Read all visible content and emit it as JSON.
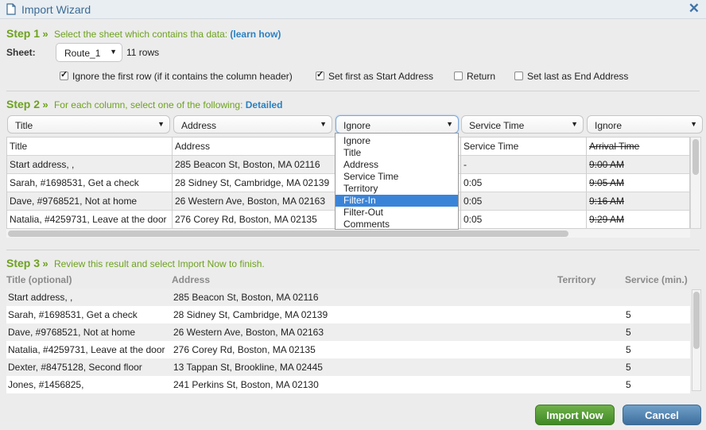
{
  "window": {
    "title": "Import Wizard",
    "close_label": "✕"
  },
  "step1": {
    "label": "Step 1",
    "text": "Select the sheet which contains tha data:",
    "link": "(learn how)",
    "sheet_label": "Sheet:",
    "sheet_value": "Route_1",
    "rows_count": "11 rows",
    "checkboxes": [
      {
        "label": "Ignore the first row (if it contains the column header)",
        "checked": true
      },
      {
        "label": "Set first as Start Address",
        "checked": true
      },
      {
        "label": "Return",
        "checked": false
      },
      {
        "label": "Set last as End Address",
        "checked": false
      }
    ]
  },
  "step2": {
    "label": "Step 2",
    "text": "For each column, select one of the following:",
    "link": "Detailed",
    "column_selects": [
      "Title",
      "Address",
      "Ignore",
      "Service Time",
      "Ignore"
    ],
    "dropdown_options": [
      "Ignore",
      "Title",
      "Address",
      "Service Time",
      "Territory",
      "Filter-In",
      "Filter-Out",
      "Comments"
    ],
    "dropdown_selected": "Filter-In",
    "table": {
      "rows": [
        [
          "Title",
          "Address",
          "",
          "Service Time",
          "Arrival Time"
        ],
        [
          "Start address, ,",
          "285 Beacon St, Boston, MA 02116",
          "",
          "-",
          "9:00 AM"
        ],
        [
          "Sarah, #1698531, Get a check",
          "28 Sidney St, Cambridge, MA 02139",
          "",
          "0:05",
          "9:05 AM"
        ],
        [
          "Dave, #9768521, Not at home",
          "26 Western Ave, Boston, MA 02163",
          "",
          "0:05",
          "9:16 AM"
        ],
        [
          "Natalia, #4259731, Leave at the door",
          "276 Corey Rd, Boston, MA 02135",
          "",
          "0:05",
          "9:29 AM"
        ]
      ]
    }
  },
  "step3": {
    "label": "Step 3",
    "text": "Review this result and select Import Now to finish.",
    "headers": [
      "Title (optional)",
      "Address",
      "Territory",
      "Service (min.)"
    ],
    "rows": [
      [
        "Start address, ,",
        "285 Beacon St, Boston, MA 02116",
        "",
        ""
      ],
      [
        "Sarah, #1698531, Get a check",
        "28 Sidney St, Cambridge, MA 02139",
        "",
        "5"
      ],
      [
        "Dave, #9768521, Not at home",
        "26 Western Ave, Boston, MA 02163",
        "",
        "5"
      ],
      [
        "Natalia, #4259731, Leave at the door",
        "276 Corey Rd, Boston, MA 02135",
        "",
        "5"
      ],
      [
        "Dexter, #8475128, Second floor",
        "13 Tappan St, Brookline, MA 02445",
        "",
        "5"
      ],
      [
        "Jones, #1456825,",
        "241 Perkins St, Boston, MA 02130",
        "",
        "5"
      ]
    ]
  },
  "buttons": {
    "import": "Import Now",
    "cancel": "Cancel"
  },
  "colors": {
    "step_green": "#6ea21e",
    "link_blue": "#2b81c2",
    "import_green": "#4f9a30",
    "cancel_blue": "#4f80ad",
    "highlight": "#3a84d8"
  }
}
